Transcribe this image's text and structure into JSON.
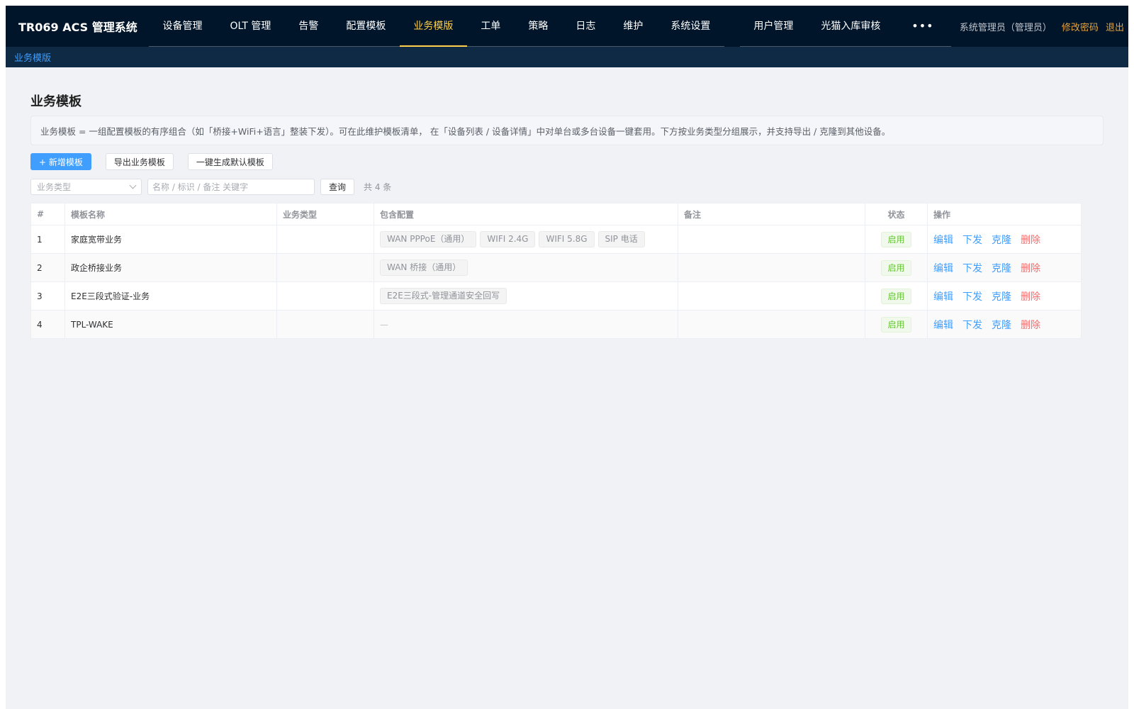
{
  "app": {
    "title": "TR069 ACS 管理系统"
  },
  "nav": {
    "group1": [
      {
        "label": "设备管理",
        "active": false
      },
      {
        "label": "OLT 管理",
        "active": false
      },
      {
        "label": "告警",
        "active": false
      },
      {
        "label": "配置模板",
        "active": false
      },
      {
        "label": "业务模版",
        "active": true
      },
      {
        "label": "工单",
        "active": false
      },
      {
        "label": "策略",
        "active": false
      },
      {
        "label": "日志",
        "active": false
      },
      {
        "label": "维护",
        "active": false
      },
      {
        "label": "系统设置",
        "active": false
      }
    ],
    "group2": [
      {
        "label": "用户管理",
        "active": false
      },
      {
        "label": "光猫入库审核",
        "active": false
      }
    ],
    "more": "•••"
  },
  "user": {
    "name": "系统管理员（管理员）",
    "change_password": "修改密码",
    "logout": "退出"
  },
  "breadcrumb": {
    "current": "业务模版"
  },
  "page": {
    "title": "业务模板",
    "description": "业务模板 = 一组配置模板的有序组合（如「桥接+WiFi+语言」整装下发）。可在此维护模板清单， 在「设备列表 / 设备详情」中对单台或多台设备一键套用。下方按业务类型分组展示，并支持导出 / 克隆到其他设备。"
  },
  "toolbar": {
    "add": "+ 新增模板",
    "export": "导出业务模板",
    "generate": "一键生成默认模板"
  },
  "filters": {
    "type_placeholder": "业务类型",
    "keyword_placeholder": "名称 / 标识 / 备注 关键字",
    "query": "查询",
    "total": "共 4 条"
  },
  "table": {
    "headers": {
      "index": "#",
      "name": "模板名称",
      "type": "业务类型",
      "configs": "包含配置",
      "remark": "备注",
      "status": "状态",
      "actions": "操作"
    },
    "rows": [
      {
        "index": "1",
        "name": "家庭宽带业务",
        "type": "",
        "configs": [
          "WAN PPPoE（通用）",
          "WIFI 2.4G",
          "WIFI 5.8G",
          "SIP 电话"
        ],
        "remark": "",
        "status": "启用"
      },
      {
        "index": "2",
        "name": "政企桥接业务",
        "type": "",
        "configs": [
          "WAN 桥接（通用）"
        ],
        "remark": "",
        "status": "启用"
      },
      {
        "index": "3",
        "name": "E2E三段式验证-业务",
        "type": "",
        "configs": [
          "E2E三段式-管理通道安全回写"
        ],
        "remark": "",
        "status": "启用"
      },
      {
        "index": "4",
        "name": "TPL-WAKE",
        "type": "",
        "configs": [],
        "configs_empty": "—",
        "remark": "",
        "status": "启用"
      }
    ],
    "actions": {
      "edit": "编辑",
      "deploy": "下发",
      "clone": "克隆",
      "delete": "删除"
    }
  },
  "colors": {
    "topbar": "#001529",
    "active_nav": "#ffd04b",
    "primary": "#409eff",
    "danger": "#f56c6c",
    "success": "#67c23a",
    "accent_link": "#e6a23c"
  }
}
